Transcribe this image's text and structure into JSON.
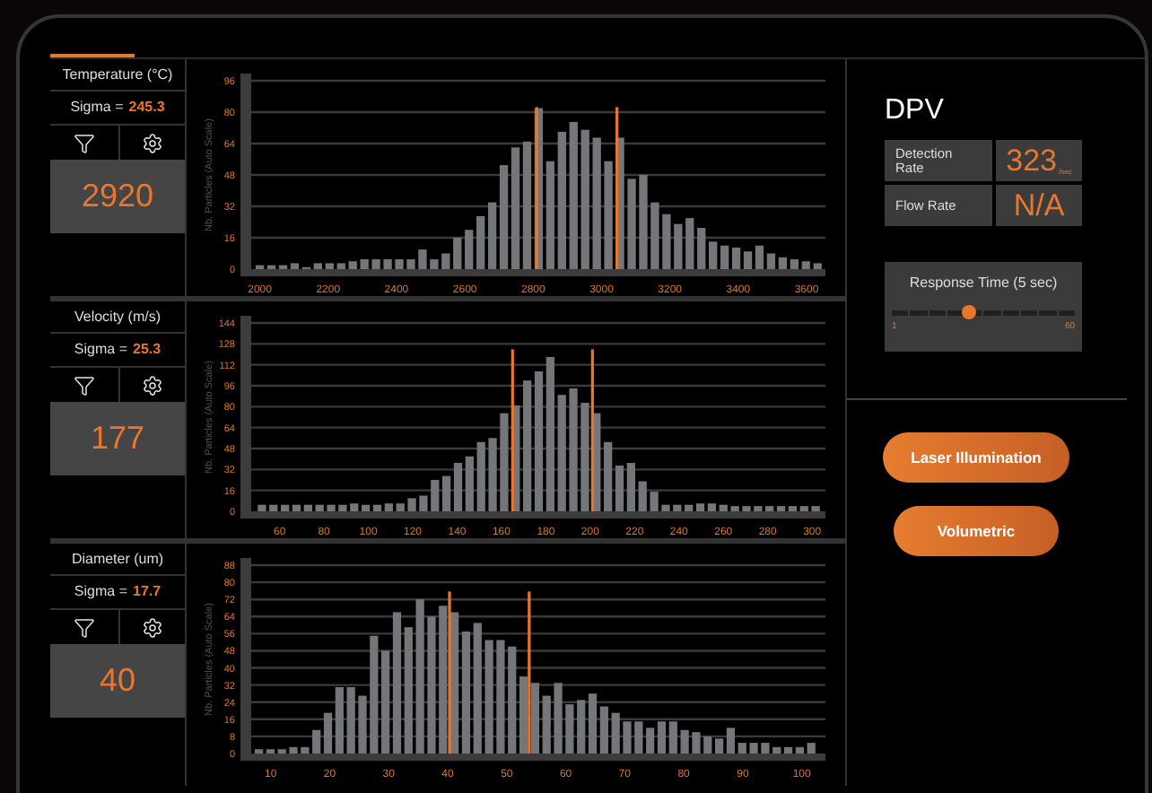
{
  "channels": [
    {
      "title": "Temperature (°C)",
      "sigma_label": "Sigma =",
      "sigma_value": "245.3",
      "value": "2920",
      "chart_data": {
        "type": "bar",
        "ylabel": "Nb. Particles (Auto Scale)",
        "grid": true,
        "xlim": [
          1980,
          3655
        ],
        "ylim": [
          0,
          96
        ],
        "xticks": [
          2000,
          2200,
          2400,
          2600,
          2800,
          3000,
          3200,
          3400,
          3600
        ],
        "yticks": [
          0,
          16,
          32,
          48,
          64,
          80,
          96
        ],
        "x": [
          2000,
          2034,
          2068,
          2102,
          2136,
          2170,
          2204,
          2238,
          2272,
          2306,
          2340,
          2374,
          2408,
          2442,
          2476,
          2510,
          2544,
          2578,
          2612,
          2646,
          2680,
          2714,
          2748,
          2782,
          2816,
          2850,
          2884,
          2918,
          2952,
          2986,
          3020,
          3054,
          3088,
          3122,
          3156,
          3190,
          3224,
          3258,
          3292,
          3326,
          3360,
          3394,
          3428,
          3462,
          3496,
          3530,
          3564,
          3598,
          3632
        ],
        "values": [
          2,
          2,
          2,
          3,
          1,
          3,
          3,
          3,
          4,
          5,
          5,
          5,
          5,
          5,
          10,
          5,
          8,
          16,
          20,
          27,
          34,
          53,
          62,
          65,
          82,
          55,
          70,
          75,
          71,
          67,
          55,
          67,
          46,
          48,
          34,
          28,
          23,
          26,
          21,
          14,
          12,
          11,
          9,
          12,
          8,
          6,
          5,
          4,
          3
        ],
        "ref_lines": [
          {
            "axis": "x",
            "value": 2810
          },
          {
            "axis": "x",
            "value": 3045
          }
        ]
      }
    },
    {
      "title": "Velocity (m/s)",
      "sigma_label": "Sigma =",
      "sigma_value": "25.3",
      "value": "177",
      "chart_data": {
        "type": "bar",
        "ylabel": "Nb. Particles (Auto Scale)",
        "grid": true,
        "xlim": [
          48,
          306
        ],
        "ylim": [
          0,
          144
        ],
        "xticks": [
          60,
          80,
          100,
          120,
          140,
          160,
          180,
          200,
          220,
          240,
          260,
          280,
          300
        ],
        "yticks": [
          0,
          16,
          32,
          48,
          64,
          80,
          96,
          112,
          128,
          144
        ],
        "x": [
          52,
          57.2,
          62.4,
          67.6,
          72.8,
          78,
          83.2,
          88.4,
          93.6,
          98.8,
          104,
          109.2,
          114.4,
          119.6,
          124.8,
          130,
          135.2,
          140.4,
          145.6,
          150.8,
          156,
          161.2,
          166.4,
          171.6,
          176.8,
          182,
          187.2,
          192.4,
          197.6,
          202.8,
          208,
          213.2,
          218.4,
          223.6,
          228.8,
          234,
          239.2,
          244.4,
          249.6,
          254.8,
          260,
          265.2,
          270.4,
          275.6,
          280.8,
          286,
          291.2,
          296.4,
          301.6
        ],
        "values": [
          5,
          5,
          5,
          5,
          5,
          5,
          5,
          5,
          6,
          5,
          5,
          6,
          6,
          10,
          12,
          24,
          27,
          37,
          42,
          53,
          56,
          75,
          81,
          100,
          107,
          118,
          89,
          94,
          83,
          75,
          53,
          35,
          37,
          23,
          15,
          5,
          5,
          5,
          6,
          6,
          5,
          4,
          4,
          4,
          4,
          4,
          4,
          4,
          4
        ],
        "ref_lines": [
          {
            "axis": "x",
            "value": 165
          },
          {
            "axis": "x",
            "value": 201
          }
        ]
      }
    },
    {
      "title": "Diameter (um)",
      "sigma_label": "Sigma =",
      "sigma_value": "17.7",
      "value": "40",
      "chart_data": {
        "type": "bar",
        "ylabel": "Nb. Particles (Auto Scale)",
        "grid": true,
        "xlim": [
          7,
          104
        ],
        "ylim": [
          0,
          88
        ],
        "xticks": [
          10,
          20,
          30,
          40,
          50,
          60,
          70,
          80,
          90,
          100
        ],
        "yticks": [
          0,
          8,
          16,
          24,
          32,
          40,
          48,
          56,
          64,
          72,
          80,
          88
        ],
        "x": [
          8,
          9.95,
          11.9,
          13.85,
          15.8,
          17.75,
          19.7,
          21.65,
          23.6,
          25.55,
          27.5,
          29.45,
          31.4,
          33.35,
          35.3,
          37.25,
          39.2,
          41.15,
          43.1,
          45.05,
          47,
          48.95,
          50.9,
          52.85,
          54.8,
          56.75,
          58.7,
          60.65,
          62.6,
          64.55,
          66.5,
          68.45,
          70.4,
          72.35,
          74.3,
          76.25,
          78.2,
          80.15,
          82.1,
          84.05,
          86,
          87.95,
          89.9,
          91.85,
          93.8,
          95.75,
          97.7,
          99.65,
          101.6
        ],
        "values": [
          2,
          2,
          2,
          3,
          3,
          11,
          19,
          31,
          31,
          27,
          55,
          48,
          66,
          59,
          72,
          64,
          69,
          66,
          57,
          61,
          53,
          53,
          50,
          36,
          33,
          27,
          33,
          23,
          25,
          28,
          22,
          19,
          15,
          15,
          12,
          15,
          15,
          11,
          10,
          8,
          7,
          12,
          5,
          5,
          5,
          3,
          3,
          3,
          5
        ],
        "ref_lines": [
          {
            "axis": "x",
            "value": 40.3
          },
          {
            "axis": "x",
            "value": 53.8
          }
        ]
      }
    }
  ],
  "dpv": {
    "title": "DPV",
    "metrics": [
      {
        "label": "Detection Rate",
        "value": "323",
        "unit": "/sec"
      },
      {
        "label": "Flow Rate",
        "value": "N/A"
      }
    ],
    "response_time": {
      "label": "Response Time (5 sec)",
      "level": 0.42,
      "min": "1",
      "max": "60"
    }
  },
  "buttons": [
    "Laser Illumination",
    "Volumetric"
  ]
}
